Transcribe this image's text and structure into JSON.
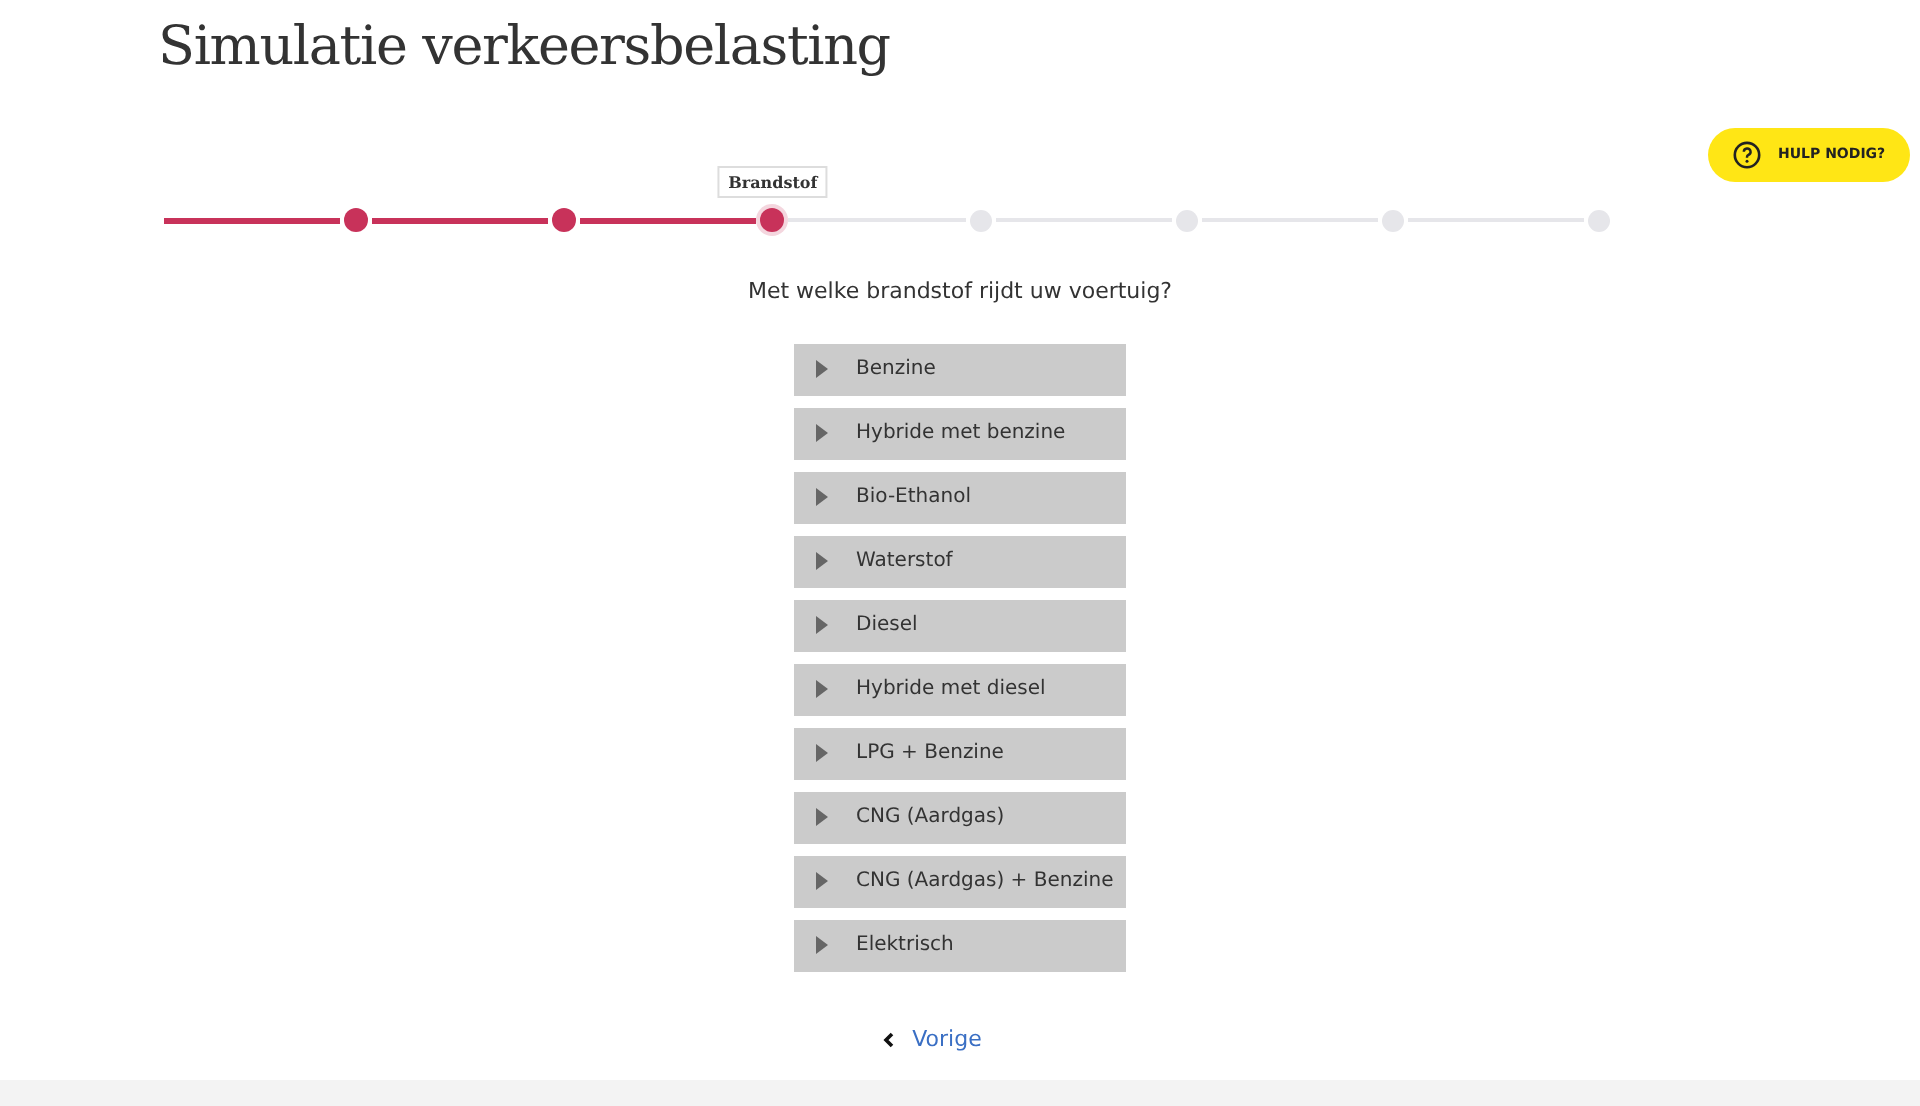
{
  "title": "Simulatie verkeersbelasting",
  "help_button": {
    "label": "HULP NODIG?"
  },
  "steps": [
    {
      "completed": true,
      "selected": false
    },
    {
      "completed": true,
      "selected": false
    },
    {
      "completed": true,
      "selected": true,
      "tooltip": "Brandstof"
    },
    {
      "completed": false,
      "selected": false
    },
    {
      "completed": false,
      "selected": false
    },
    {
      "completed": false,
      "selected": false
    },
    {
      "completed": false,
      "selected": false
    }
  ],
  "question": "Met welke brandstof rijdt uw voertuig?",
  "options": [
    {
      "label": "Benzine"
    },
    {
      "label": "Hybride met benzine"
    },
    {
      "label": "Bio-Ethanol"
    },
    {
      "label": "Waterstof"
    },
    {
      "label": "Diesel"
    },
    {
      "label": "Hybride met diesel"
    },
    {
      "label": "LPG + Benzine"
    },
    {
      "label": "CNG (Aardgas)"
    },
    {
      "label": "CNG (Aardgas) + Benzine"
    },
    {
      "label": "Elektrisch"
    }
  ],
  "back_link": {
    "label": "Vorige"
  }
}
